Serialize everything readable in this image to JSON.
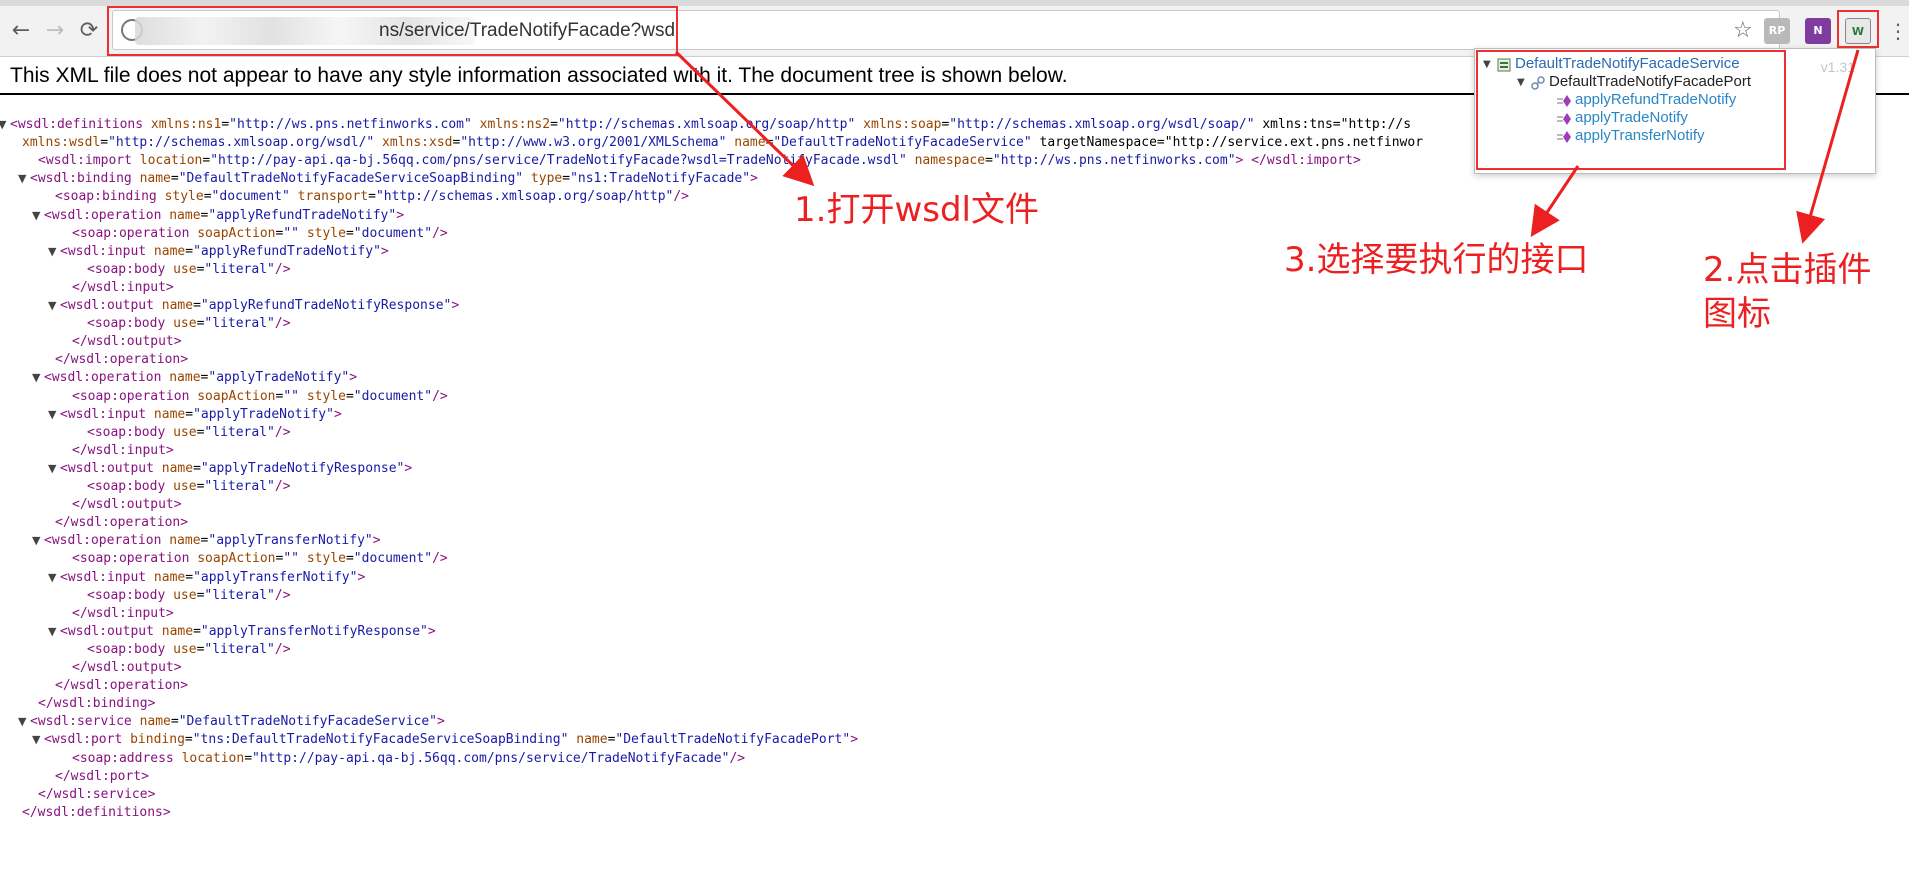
{
  "browser": {
    "nav": {
      "back_icon": "←",
      "forward_icon": "→",
      "reload_icon": "⟳"
    },
    "url_visible": "ns/service/TradeNotifyFacade?wsdl",
    "bookmark_icon": "☆",
    "extensions": [
      {
        "name": "rp-extension-icon",
        "label": "RP"
      },
      {
        "name": "onenote-extension-icon",
        "label": "N"
      },
      {
        "name": "wsdl-plugin-icon",
        "label": "W"
      }
    ],
    "menu_icon": "⋮"
  },
  "page": {
    "notice": "This XML file does not appear to have any style information associated with it. The document tree is shown below."
  },
  "xml_lines": [
    {
      "toggle": "▼",
      "text": "<wsdl:definitions xmlns:ns1=\"http://ws.pns.netfinworks.com\" xmlns:ns2=\"http://schemas.xmlsoap.org/soap/http\" xmlns:soap=\"http://schemas.xmlsoap.org/wsdl/soap/\" xmlns:tns=\"http://s"
    },
    {
      "toggle": "",
      "text": "xmlns:wsdl=\"http://schemas.xmlsoap.org/wsdl/\" xmlns:xsd=\"http://www.w3.org/2001/XMLSchema\" name=\"DefaultTradeNotifyFacadeService\" targetNamespace=\"http://service.ext.pns.netfinwor"
    },
    {
      "toggle": "",
      "text": "<wsdl:import location=\"http://pay-api.qa-bj.56qq.com/pns/service/TradeNotifyFacade?wsdl=TradeNotifyFacade.wsdl\" namespace=\"http://ws.pns.netfinworks.com\"> </wsdl:import>"
    },
    {
      "toggle": "▼",
      "text": "<wsdl:binding name=\"DefaultTradeNotifyFacadeServiceSoapBinding\" type=\"ns1:TradeNotifyFacade\">"
    },
    {
      "toggle": "",
      "text": "<soap:binding style=\"document\" transport=\"http://schemas.xmlsoap.org/soap/http\"/>"
    },
    {
      "toggle": "▼",
      "text": "<wsdl:operation name=\"applyRefundTradeNotify\">"
    },
    {
      "toggle": "",
      "text": "<soap:operation soapAction=\"\" style=\"document\"/>"
    },
    {
      "toggle": "▼",
      "text": "<wsdl:input name=\"applyRefundTradeNotify\">"
    },
    {
      "toggle": "",
      "text": "<soap:body use=\"literal\"/>"
    },
    {
      "toggle": "",
      "text": "</wsdl:input>"
    },
    {
      "toggle": "▼",
      "text": "<wsdl:output name=\"applyRefundTradeNotifyResponse\">"
    },
    {
      "toggle": "",
      "text": "<soap:body use=\"literal\"/>"
    },
    {
      "toggle": "",
      "text": "</wsdl:output>"
    },
    {
      "toggle": "",
      "text": "</wsdl:operation>"
    },
    {
      "toggle": "▼",
      "text": "<wsdl:operation name=\"applyTradeNotify\">"
    },
    {
      "toggle": "",
      "text": "<soap:operation soapAction=\"\" style=\"document\"/>"
    },
    {
      "toggle": "▼",
      "text": "<wsdl:input name=\"applyTradeNotify\">"
    },
    {
      "toggle": "",
      "text": "<soap:body use=\"literal\"/>"
    },
    {
      "toggle": "",
      "text": "</wsdl:input>"
    },
    {
      "toggle": "▼",
      "text": "<wsdl:output name=\"applyTradeNotifyResponse\">"
    },
    {
      "toggle": "",
      "text": "<soap:body use=\"literal\"/>"
    },
    {
      "toggle": "",
      "text": "</wsdl:output>"
    },
    {
      "toggle": "",
      "text": "</wsdl:operation>"
    },
    {
      "toggle": "▼",
      "text": "<wsdl:operation name=\"applyTransferNotify\">"
    },
    {
      "toggle": "",
      "text": "<soap:operation soapAction=\"\" style=\"document\"/>"
    },
    {
      "toggle": "▼",
      "text": "<wsdl:input name=\"applyTransferNotify\">"
    },
    {
      "toggle": "",
      "text": "<soap:body use=\"literal\"/>"
    },
    {
      "toggle": "",
      "text": "</wsdl:input>"
    },
    {
      "toggle": "▼",
      "text": "<wsdl:output name=\"applyTransferNotifyResponse\">"
    },
    {
      "toggle": "",
      "text": "<soap:body use=\"literal\"/>"
    },
    {
      "toggle": "",
      "text": "</wsdl:output>"
    },
    {
      "toggle": "",
      "text": "</wsdl:operation>"
    },
    {
      "toggle": "",
      "text": "</wsdl:binding>"
    },
    {
      "toggle": "▼",
      "text": "<wsdl:service name=\"DefaultTradeNotifyFacadeService\">"
    },
    {
      "toggle": "▼",
      "text": "<wsdl:port binding=\"tns:DefaultTradeNotifyFacadeServiceSoapBinding\" name=\"DefaultTradeNotifyFacadePort\">"
    },
    {
      "toggle": "",
      "text": "<soap:address location=\"http://pay-api.qa-bj.56qq.com/pns/service/TradeNotifyFacade\"/>"
    },
    {
      "toggle": "",
      "text": "</wsdl:port>"
    },
    {
      "toggle": "",
      "text": "</wsdl:service>"
    },
    {
      "toggle": "",
      "text": "</wsdl:definitions>"
    }
  ],
  "plugin_popup": {
    "version": "v1.31",
    "service": "DefaultTradeNotifyFacadeService",
    "port": "DefaultTradeNotifyFacadePort",
    "operations": [
      "applyRefundTradeNotify",
      "applyTradeNotify",
      "applyTransferNotify"
    ]
  },
  "annotations": {
    "step1": "1.打开wsdl文件",
    "step2_line1": "2.点击插件",
    "step2_line2": "图标",
    "step3": "3.选择要执行的接口",
    "color": "#ec2020"
  }
}
